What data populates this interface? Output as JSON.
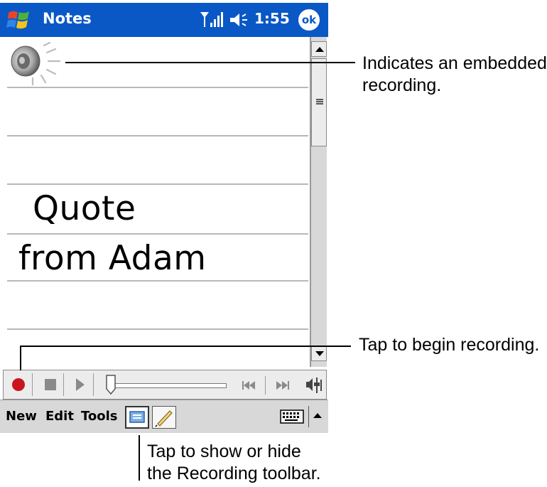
{
  "titlebar": {
    "app_title": "Notes",
    "time": "1:55",
    "ok_label": "ok"
  },
  "note": {
    "lines": [
      "Quote",
      "from Adam"
    ]
  },
  "menubar": {
    "items": [
      "New",
      "Edit",
      "Tools"
    ]
  },
  "callouts": {
    "embedded_recording": [
      "Indicates an embedded",
      "recording."
    ],
    "begin_recording": "Tap to begin recording.",
    "toolbar_toggle": [
      "Tap to show or hide",
      "the Recording toolbar."
    ]
  },
  "colors": {
    "titlebar": "#0a58c6",
    "record_dot": "#c8161c",
    "toolbar_bg": "#ececec",
    "menubar_bg": "#d8d8d8"
  },
  "icons": [
    "start-flag-icon",
    "signal-icon",
    "volume-icon",
    "speaker-recording-icon",
    "record-icon",
    "stop-icon",
    "play-icon",
    "skip-back-icon",
    "skip-forward-icon",
    "volume-control-icon",
    "recording-toolbar-icon",
    "pen-icon",
    "keyboard-icon"
  ]
}
